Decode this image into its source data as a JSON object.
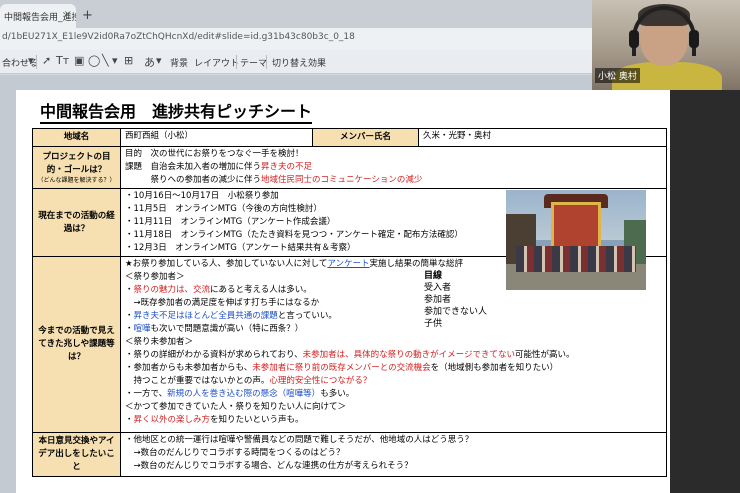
{
  "browser": {
    "tab_label": "中間報告会用_進捗共有ピッチシ",
    "tab_close": "×",
    "new_tab": "+",
    "url": "d/1bEU271X_E1le9V2id0Ra7oZtChQHcnXd/edit#slide=id.g31b43c80b3c_0_18"
  },
  "toolbar": {
    "zoom_label": "合わせる",
    "background_label": "背景",
    "layout_label": "レイアウト",
    "theme_label": "テーマ",
    "transition_label": "切り替え効果"
  },
  "webcam": {
    "name_label": "小松 奥村"
  },
  "slide": {
    "title": "中間報告会用　進捗共有ピッチシート",
    "row_area": {
      "label": "地域名",
      "value": "西町西組（小松）",
      "member_label": "メンバー氏名",
      "member_value": "久米・光野・奥村"
    },
    "row_goal": {
      "label": "プロジェクトの目的・ゴールは？",
      "sub": "（どんな課題を解決する？）",
      "l1": "目的　次の世代にお祭りをつなぐ一手を検討！",
      "l2a": "課題　自治会未加入者の増加に伴う",
      "l2b": "昇き夫の不足",
      "l3a": "　　　祭りへの参加者の減少に伴う",
      "l3b": "地域住民同士のコミュニケーションの減少"
    },
    "row_process": {
      "label": "現在までの活動の経過は？",
      "items": [
        "・10月16日〜10月17日　小松祭り参加",
        "・11月5日　オンラインMTG（今後の方向性検討）",
        "・11月11日　オンラインMTG（アンケート作成会議）",
        "・11月18日　オンラインMTG（たたき資料を見つつ・アンケート確定・配布方法確認）",
        "・12月3日　オンラインMTG（アンケート結果共有＆考察）"
      ]
    },
    "row_findings": {
      "label": "今までの活動で見えてきた兆しや課題等は？",
      "intro_a": "★お祭り参加している人、参加していない人に対して",
      "intro_link": "アンケート",
      "intro_b": "実施し結果の簡単な総評",
      "participants_head": "＜祭り参加者＞",
      "p1a": "・",
      "p1b": "祭りの魅力は、交流",
      "p1c": "にあると考える人は多い。",
      "p2": "　→既存参加者の満足度を伸ばす打ち手にはなるか",
      "p3a": "・",
      "p3b": "昇き夫不足はほとんど全員共通の課題",
      "p3c": "と言っていい。",
      "p4a": "・",
      "p4b": "喧嘩",
      "p4c": "も次いで問題意識が高い（特に西条？）",
      "non_head": "＜祭り未参加者＞",
      "n1a": "・祭りの詳細がわかる資料が求められており、",
      "n1b": "未参加者は、具体的な祭りの動きがイメージできてない",
      "n1c": "可能性が高い。",
      "n2a": "・参加者からも未参加者からも、",
      "n2b": "未参加者に祭り前の既存メンバーとの交流機会",
      "n2c": "を（地域側も参加者を知りたい）",
      "n3a": "　持つことが重要ではないかとの声。",
      "n3b": "心理的安全性につながる？",
      "n4a": "・一方で、",
      "n4b": "新規の人を巻き込む際の懸念（喧嘩等）",
      "n4c": "も多い。",
      "past_head": "＜かつて参加できていた人・祭りを知りたい人に向けて＞",
      "q1a": "・",
      "q1b": "昇く以外の楽しみ方",
      "q1c": "を知りたいという声も。",
      "viewpoint": [
        "目線",
        "受入者",
        "参加者",
        "参加できない人",
        "子供"
      ]
    },
    "row_ideas": {
      "label": "本日意見交換やアイデア出しをしたいこと",
      "items": [
        "・他地区との統一運行は喧嘩や警備員などの問題で難しそうだが、他地域の人はどう思う？",
        "　→数台のだんじりでコラボする時間をつくるのはどう？",
        "　→数台のだんじりでコラボする場合、どんな連携の仕方が考えられそう？"
      ]
    }
  }
}
